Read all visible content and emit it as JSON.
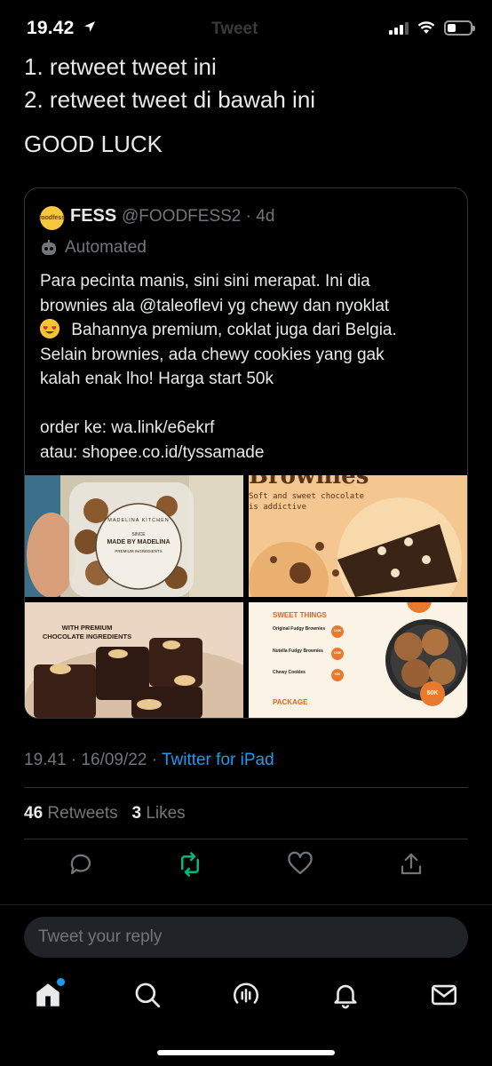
{
  "status_bar": {
    "time": "19.42",
    "ghost_title": "Tweet"
  },
  "tweet": {
    "lines": [
      "1. retweet tweet ini",
      "2. retweet tweet di bawah ini",
      "GOOD LUCK"
    ]
  },
  "quote": {
    "avatar_text": "foodfess",
    "name": "FESS",
    "handle": "@FOODFESS2 · 4d",
    "automated_label": "Automated",
    "body_lines": [
      "Para pecinta manis, sini sini merapat. Ini dia",
      "brownies ala @taleoflevi yg chewy dan nyoklat",
      "Bahannya premium, coklat juga dari Belgia.",
      "Selain brownies, ada chewy cookies yang gak",
      "kalah enak lho! Harga start 50k",
      "order ke: wa.link/e6ekrf",
      "atau: shopee.co.id/tyssamade"
    ],
    "emoji": "smiling-face-with-heart-eyes",
    "images": {
      "img1": {
        "brand": "MADELINA KITCHEN",
        "label": "MADE BY MADELINA",
        "sub": "PREMIUM INGREDIENTS",
        "since": "SINCE"
      },
      "img2": {
        "title": "Brownies",
        "subtitle_1": "Soft and sweet chocolate",
        "subtitle_2": "is addictive"
      },
      "img3": {
        "caption_1": "WITH PREMIUM",
        "caption_2": "CHOCOLATE INGREDIENTS"
      },
      "img4": {
        "title": "SWEET THINGS",
        "items": [
          {
            "name": "Original Fudgy Brownies",
            "price": "100K"
          },
          {
            "name": "Nutella Fudgy Brownies",
            "price": "100K"
          },
          {
            "name": "Chewy Cookies",
            "price": "50K"
          }
        ],
        "section": "PACKAGE",
        "badge": "50K"
      }
    }
  },
  "meta": {
    "timestamp": "19.41 · 16/09/22 · ",
    "source": "Twitter for iPad"
  },
  "stats": {
    "retweets_count": "46",
    "retweets_label": "Retweets",
    "likes_count": "3",
    "likes_label": "Likes"
  },
  "reply": {
    "placeholder": "Tweet your reply"
  },
  "colors": {
    "accent": "#1d9bf0",
    "retweet_active": "#00ba7c",
    "muted": "#71767b",
    "background": "#000000"
  }
}
